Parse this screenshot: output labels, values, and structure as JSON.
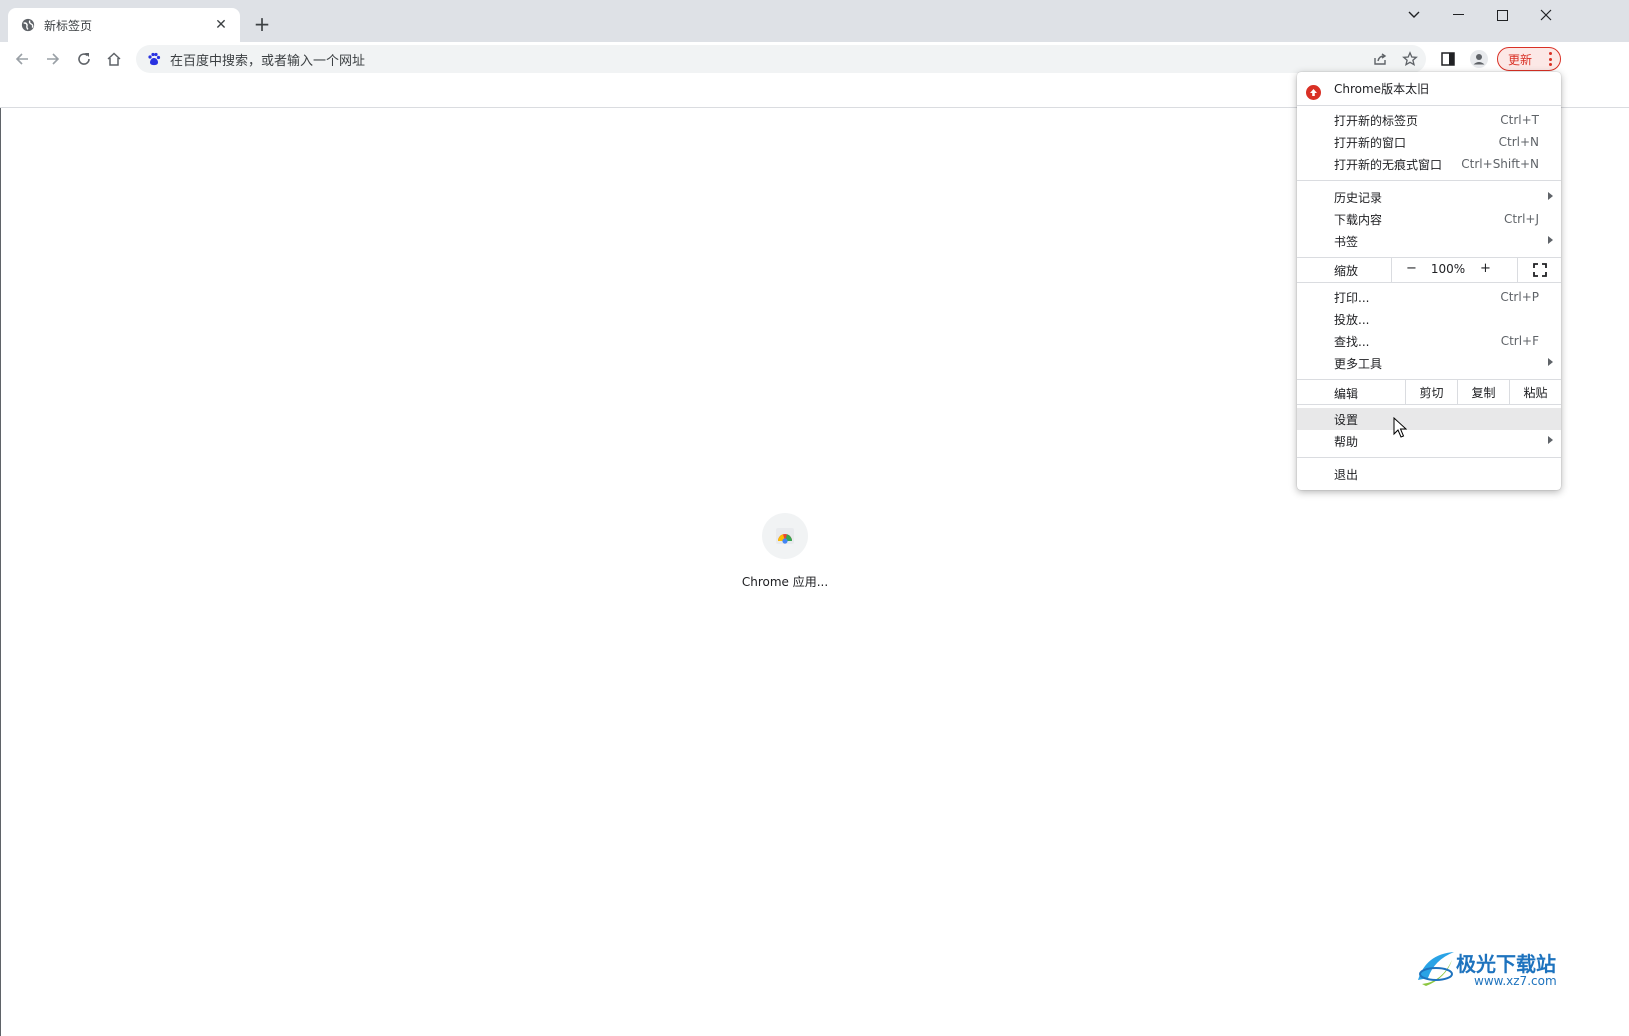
{
  "tab": {
    "title": "新标签页"
  },
  "toolbar": {
    "omnibox_placeholder": "在百度中搜索，或者输入一个网址",
    "update_label": "更新"
  },
  "content": {
    "shortcut_label": "Chrome 应用..."
  },
  "menu": {
    "header": "Chrome版本太旧",
    "new_tab": {
      "label": "打开新的标签页",
      "shortcut": "Ctrl+T"
    },
    "new_window": {
      "label": "打开新的窗口",
      "shortcut": "Ctrl+N"
    },
    "incognito": {
      "label": "打开新的无痕式窗口",
      "shortcut": "Ctrl+Shift+N"
    },
    "history": {
      "label": "历史记录"
    },
    "downloads": {
      "label": "下载内容",
      "shortcut": "Ctrl+J"
    },
    "bookmarks": {
      "label": "书签"
    },
    "zoom": {
      "label": "缩放",
      "minus": "−",
      "value": "100%",
      "plus": "+"
    },
    "print": {
      "label": "打印...",
      "shortcut": "Ctrl+P"
    },
    "cast": {
      "label": "投放..."
    },
    "find": {
      "label": "查找...",
      "shortcut": "Ctrl+F"
    },
    "more_tools": {
      "label": "更多工具"
    },
    "edit": {
      "label": "编辑",
      "cut": "剪切",
      "copy": "复制",
      "paste": "粘贴"
    },
    "settings": {
      "label": "设置"
    },
    "help": {
      "label": "帮助"
    },
    "exit": {
      "label": "退出"
    }
  },
  "watermark": {
    "text": "极光下载站",
    "url": "www.xz7.com"
  },
  "colors": {
    "accent_red": "#d93025",
    "tab_strip": "#dee1e6",
    "omnibox": "#f1f3f4"
  }
}
